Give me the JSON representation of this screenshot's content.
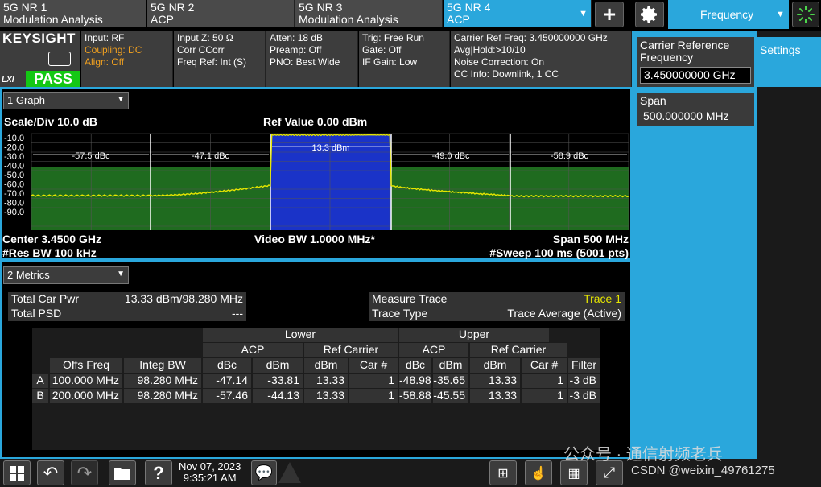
{
  "tabs": [
    {
      "line1": "5G NR 1",
      "line2": "Modulation Analysis"
    },
    {
      "line1": "5G NR 2",
      "line2": "ACP"
    },
    {
      "line1": "5G NR 3",
      "line2": "Modulation Analysis"
    },
    {
      "line1": "5G NR 4",
      "line2": "ACP"
    }
  ],
  "top": {
    "frequency_label": "Frequency"
  },
  "brand": {
    "logo": "KEYSIGHT",
    "lxi": "LXI",
    "status": "PASS"
  },
  "info": {
    "col1": [
      "Input: RF",
      "Coupling: DC",
      "Align: Off"
    ],
    "col2": [
      "Input Z: 50 Ω",
      "Corr CCorr",
      "Freq Ref: Int (S)"
    ],
    "col3": [
      "Atten: 18 dB",
      "Preamp: Off",
      "PNO: Best Wide"
    ],
    "col4": [
      "Trig: Free Run",
      "Gate: Off",
      "IF Gain: Low"
    ],
    "col5": [
      "Carrier Ref Freq: 3.450000000 GHz",
      "Avg|Hold:>10/10",
      "Noise Correction: On",
      "CC Info: Downlink, 1 CC"
    ]
  },
  "side": {
    "carrier_label": "Carrier Reference Frequency",
    "carrier_value": "3.450000000 GHz",
    "span_label": "Span",
    "span_value": "500.000000 MHz",
    "settings_tab": "Settings"
  },
  "graph": {
    "dropdown": "1 Graph",
    "scale": "Scale/Div 10.0 dB",
    "ref": "Ref Value 0.00 dBm",
    "yticks": [
      "-10.0",
      "-20.0",
      "-30.0",
      "-40.0",
      "-50.0",
      "-60.0",
      "-70.0",
      "-80.0",
      "-90.0"
    ],
    "segment_labels": [
      "-57.5 dBc",
      "-47.1 dBc",
      "13.3 dBm",
      "-49.0 dBc",
      "-58.9 dBc"
    ],
    "center": "Center 3.4500 GHz",
    "vbw": "Video BW 1.0000 MHz*",
    "span": "Span 500 MHz",
    "rbw": "#Res BW 100 kHz",
    "sweep": "#Sweep 100 ms (5001 pts)",
    "colors": {
      "trace": "#e6e600",
      "mask": "#1f6b1f",
      "carrier": "#1a33c8",
      "frame": "#2aa7dc"
    }
  },
  "metrics": {
    "dropdown": "2 Metrics",
    "total_car_pwr_label": "Total Car Pwr",
    "total_car_pwr_value": "13.33 dBm/98.280 MHz",
    "total_psd_label": "Total PSD",
    "total_psd_value": "---",
    "measure_trace_label": "Measure Trace",
    "measure_trace_value": "Trace 1",
    "trace_type_label": "Trace Type",
    "trace_type_value": "Trace Average (Active)",
    "table": {
      "lower": "Lower",
      "upper": "Upper",
      "acp": "ACP",
      "ref_carrier": "Ref Carrier",
      "cols": [
        "Offs Freq",
        "Integ BW",
        "dBc",
        "dBm",
        "dBm",
        "Car #",
        "dBc",
        "dBm",
        "dBm",
        "Car #",
        "Filter"
      ],
      "rows": [
        [
          "A",
          "100.000 MHz",
          "98.280 MHz",
          "-47.14",
          "-33.81",
          "13.33",
          "1",
          "-48.98",
          "-35.65",
          "13.33",
          "1",
          "-3 dB"
        ],
        [
          "B",
          "200.000 MHz",
          "98.280 MHz",
          "-57.46",
          "-44.13",
          "13.33",
          "1",
          "-58.88",
          "-45.55",
          "13.33",
          "1",
          "-3 dB"
        ]
      ]
    }
  },
  "taskbar": {
    "date": "Nov 07, 2023",
    "time": "9:35:21 AM"
  },
  "watermark": {
    "line1": "公众号 · 通信射频老兵",
    "line2": "CSDN @weixin_49761275"
  }
}
